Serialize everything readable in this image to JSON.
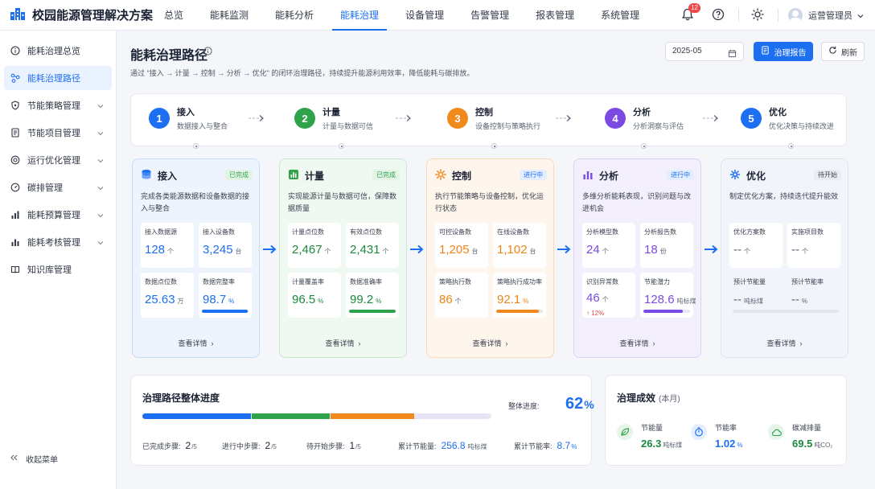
{
  "app": {
    "title": "校园能源管理解决方案"
  },
  "nav": {
    "items": [
      "总览",
      "能耗监测",
      "能耗分析",
      "能耗治理",
      "设备管理",
      "告警管理",
      "报表管理",
      "系统管理"
    ],
    "active": "能耗治理"
  },
  "header": {
    "notification_count": "12",
    "user_name": "运营管理员"
  },
  "sidebar": {
    "items": [
      {
        "label": "能耗治理总览",
        "icon": "info-circle-icon"
      },
      {
        "label": "能耗治理路径",
        "icon": "network-icon",
        "active": true
      },
      {
        "label": "节能策略管理",
        "icon": "shield-icon"
      },
      {
        "label": "节能项目管理",
        "icon": "document-icon"
      },
      {
        "label": "运行优化管理",
        "icon": "target-icon"
      },
      {
        "label": "碳排管理",
        "icon": "gauge-icon"
      },
      {
        "label": "能耗预算管理",
        "icon": "bar-chart-icon"
      },
      {
        "label": "能耗考核管理",
        "icon": "bar-chart-icon"
      },
      {
        "label": "知识库管理",
        "icon": "book-icon"
      }
    ],
    "collapse_label": "收起菜单"
  },
  "page": {
    "title": "能耗治理路径",
    "description": "通过 \"接入 → 计量 → 控制 → 分析 → 优化\" 的闭环治理路径，持续提升能源利用效率，降低能耗与碳排放。",
    "date": "2025-05",
    "report_button": "治理报告",
    "refresh_button": "刷新"
  },
  "steps": [
    {
      "num": "1",
      "name": "接入",
      "sub": "数据接入与整合",
      "color": "#1d6ff2"
    },
    {
      "num": "2",
      "name": "计量",
      "sub": "计量与数据可信",
      "color": "#2fa34a"
    },
    {
      "num": "3",
      "name": "控制",
      "sub": "设备控制与策略执行",
      "color": "#f08a1c"
    },
    {
      "num": "4",
      "name": "分析",
      "sub": "分析洞察与评估",
      "color": "#7b4ae2"
    },
    {
      "num": "5",
      "name": "优化",
      "sub": "优化决策与持续改进",
      "color": "#1d6ff2"
    }
  ],
  "cards": [
    {
      "title": "接入",
      "icon": "database-icon",
      "status": "已完成",
      "desc": "完成各类能源数据和设备数据的接入与整合",
      "link": "查看详情",
      "metrics": [
        {
          "label": "接入数据源",
          "value": "128",
          "unit": "个"
        },
        {
          "label": "接入设备数",
          "value": "3,245",
          "unit": "台"
        },
        {
          "label": "数据点位数",
          "value": "25.63",
          "unit": "万"
        },
        {
          "label": "数据完整率",
          "value": "98.7",
          "unit": "%",
          "progress": 98.7
        }
      ]
    },
    {
      "title": "计量",
      "icon": "meter-icon",
      "status": "已完成",
      "desc": "实现能源计量与数据可信，保障数据质量",
      "link": "查看详情",
      "metrics": [
        {
          "label": "计量点位数",
          "value": "2,467",
          "unit": "个"
        },
        {
          "label": "有效点位数",
          "value": "2,431",
          "unit": "个"
        },
        {
          "label": "计量覆盖率",
          "value": "96.5",
          "unit": "%"
        },
        {
          "label": "数据准确率",
          "value": "99.2",
          "unit": "%",
          "progress": 99.2
        }
      ]
    },
    {
      "title": "控制",
      "icon": "control-icon",
      "status": "进行中",
      "desc": "执行节能策略与设备控制，优化运行状态",
      "link": "查看详情",
      "metrics": [
        {
          "label": "可控设备数",
          "value": "1,205",
          "unit": "台"
        },
        {
          "label": "在线设备数",
          "value": "1,102",
          "unit": "台"
        },
        {
          "label": "策略执行数",
          "value": "86",
          "unit": "个"
        },
        {
          "label": "策略执行成功率",
          "value": "92.1",
          "unit": "%",
          "progress": 92.1
        }
      ]
    },
    {
      "title": "分析",
      "icon": "analysis-icon",
      "status": "进行中",
      "desc": "多维分析能耗表现，识别问题与改进机会",
      "link": "查看详情",
      "metrics": [
        {
          "label": "分析模型数",
          "value": "24",
          "unit": "个"
        },
        {
          "label": "分析报告数",
          "value": "18",
          "unit": "份"
        },
        {
          "label": "识别异常数",
          "value": "46",
          "unit": "个",
          "trend": "↑ 12%"
        },
        {
          "label": "节能潜力",
          "value": "128.6",
          "unit": "吨标煤",
          "progress": 85
        }
      ]
    },
    {
      "title": "优化",
      "icon": "optimize-icon",
      "status": "待开始",
      "desc": "制定优化方案，持续迭代提升能效",
      "link": "查看详情",
      "metrics": [
        {
          "label": "优化方案数",
          "value": "--",
          "unit": "个"
        },
        {
          "label": "实施项目数",
          "value": "--",
          "unit": "个"
        },
        {
          "label": "预计节能量",
          "value": "--",
          "unit": "吨标煤"
        },
        {
          "label": "预计节能率",
          "value": "--",
          "unit": "%",
          "progress": 0
        }
      ]
    }
  ],
  "progress": {
    "title": "治理路径整体进度",
    "overall_label": "整体进度:",
    "overall_value": "62",
    "overall_unit": "%",
    "segments": [
      {
        "fraction": 0.31,
        "color": "#1d6ff2"
      },
      {
        "fraction": 0.225,
        "color": "#2fa34a"
      },
      {
        "fraction": 0.24,
        "color": "#f08a1c"
      },
      {
        "fraction": 0.205,
        "color": "#e6e3f7"
      }
    ],
    "stats": [
      {
        "label": "已完成步骤:",
        "value": "2",
        "unit": "/5"
      },
      {
        "label": "进行中步骤:",
        "value": "2",
        "unit": "/5"
      },
      {
        "label": "待开始步骤:",
        "value": "1",
        "unit": "/5"
      },
      {
        "label": "累计节能量:",
        "value": "256.8",
        "unit": "吨标煤"
      },
      {
        "label": "累计节能率:",
        "value": "8.7",
        "unit": "%"
      }
    ]
  },
  "results": {
    "title": "治理成效",
    "period": "(本月)",
    "items": [
      {
        "label": "节能量",
        "value": "26.3",
        "unit": "吨标煤",
        "icon": "leaf-icon"
      },
      {
        "label": "节能率",
        "value": "1.02",
        "unit": "%",
        "icon": "timer-icon"
      },
      {
        "label": "碳减排量",
        "value": "69.5",
        "unit": "吨CO₂",
        "icon": "cloud-co2-icon"
      }
    ]
  },
  "colors": {
    "accent": "#1d6ff2",
    "green": "#2fa34a",
    "orange": "#f08a1c",
    "purple": "#7b4ae2"
  }
}
